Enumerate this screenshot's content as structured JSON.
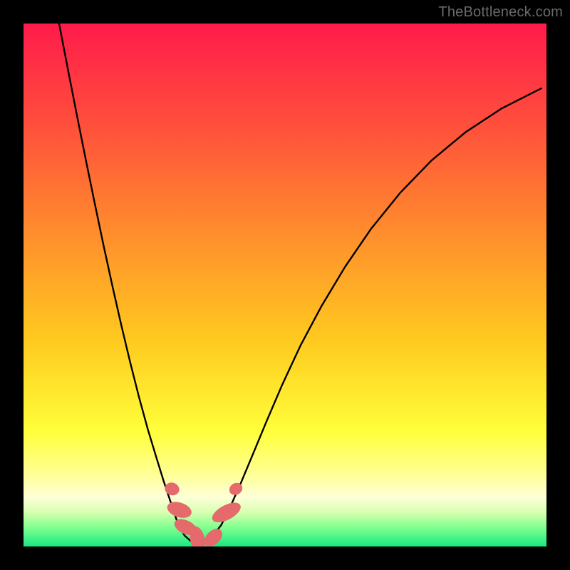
{
  "watermark": "TheBottleneck.com",
  "chart_data": {
    "type": "line",
    "title": "",
    "xlabel": "",
    "ylabel": "",
    "xlim": [
      0,
      1
    ],
    "ylim": [
      0,
      1
    ],
    "grid": false,
    "legend": false,
    "background_gradient_stops": [
      {
        "offset": 0.0,
        "color": "#ff1b4b"
      },
      {
        "offset": 0.2,
        "color": "#ff513b"
      },
      {
        "offset": 0.4,
        "color": "#ff8d2d"
      },
      {
        "offset": 0.6,
        "color": "#ffc81f"
      },
      {
        "offset": 0.78,
        "color": "#ffff3a"
      },
      {
        "offset": 0.86,
        "color": "#ffff93"
      },
      {
        "offset": 0.905,
        "color": "#ffffd8"
      },
      {
        "offset": 0.935,
        "color": "#d6ffb0"
      },
      {
        "offset": 0.965,
        "color": "#7cff8e"
      },
      {
        "offset": 1.0,
        "color": "#19e884"
      }
    ],
    "series": [
      {
        "name": "left-branch",
        "x": [
          0.068,
          0.085,
          0.102,
          0.119,
          0.136,
          0.153,
          0.17,
          0.187,
          0.204,
          0.221,
          0.238,
          0.255,
          0.268,
          0.279,
          0.288,
          0.296
        ],
        "y": [
          1.0,
          0.912,
          0.825,
          0.74,
          0.657,
          0.576,
          0.498,
          0.423,
          0.352,
          0.285,
          0.223,
          0.167,
          0.125,
          0.092,
          0.065,
          0.041
        ]
      },
      {
        "name": "basin",
        "x": [
          0.296,
          0.308,
          0.32,
          0.333,
          0.347,
          0.362,
          0.378
        ],
        "y": [
          0.041,
          0.021,
          0.01,
          0.005,
          0.008,
          0.02,
          0.041
        ]
      },
      {
        "name": "right-branch",
        "x": [
          0.378,
          0.395,
          0.415,
          0.438,
          0.465,
          0.495,
          0.53,
          0.57,
          0.615,
          0.665,
          0.72,
          0.78,
          0.845,
          0.915,
          0.99
        ],
        "y": [
          0.041,
          0.075,
          0.12,
          0.175,
          0.24,
          0.31,
          0.385,
          0.46,
          0.535,
          0.608,
          0.676,
          0.738,
          0.792,
          0.838,
          0.876
        ]
      }
    ],
    "markers": [
      {
        "cx": 0.284,
        "cy": 0.89,
        "rx": 0.012,
        "ry": 0.014,
        "angle": -72
      },
      {
        "cx": 0.298,
        "cy": 0.93,
        "rx": 0.014,
        "ry": 0.024,
        "angle": -72
      },
      {
        "cx": 0.31,
        "cy": 0.963,
        "rx": 0.013,
        "ry": 0.023,
        "angle": -65
      },
      {
        "cx": 0.333,
        "cy": 0.988,
        "rx": 0.014,
        "ry": 0.027,
        "angle": -12
      },
      {
        "cx": 0.363,
        "cy": 0.983,
        "rx": 0.013,
        "ry": 0.02,
        "angle": 45
      },
      {
        "cx": 0.388,
        "cy": 0.935,
        "rx": 0.014,
        "ry": 0.03,
        "angle": 62
      },
      {
        "cx": 0.406,
        "cy": 0.89,
        "rx": 0.011,
        "ry": 0.013,
        "angle": 58
      }
    ],
    "marker_color": "#e46a6b",
    "curve_color": "#000000",
    "curve_width": 2.4
  }
}
